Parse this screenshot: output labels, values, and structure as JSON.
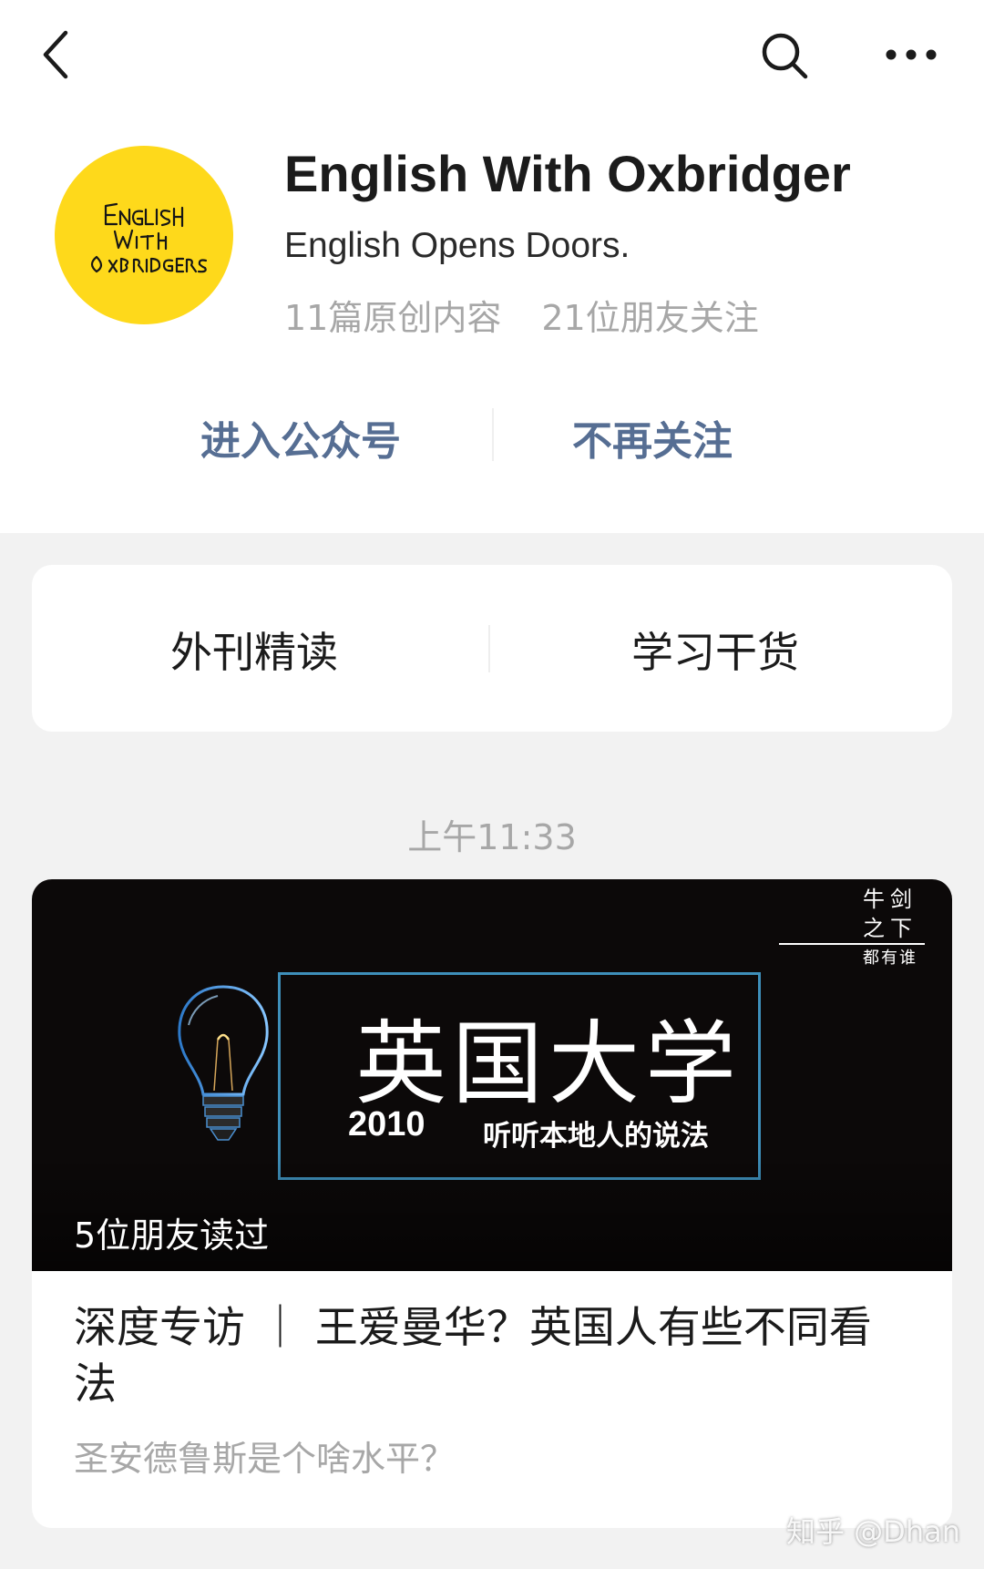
{
  "nav": {
    "back_icon": "chevron-left-icon",
    "search_icon": "search-icon",
    "more_icon": "more-horizontal-icon"
  },
  "account": {
    "avatar_text": "ENGLISH WITH OXBRIDGERS",
    "avatar_color": "#fed91b",
    "name": "English With Oxbridger",
    "slogan": "English Opens Doors.",
    "original_count": "11篇原创内容",
    "friends_following": "21位朋友关注"
  },
  "actions": {
    "enter_label": "进入公众号",
    "unfollow_label": "不再关注",
    "color": "#566e93"
  },
  "menu": {
    "items": [
      {
        "label": "外刊精读"
      },
      {
        "label": "学习干货"
      }
    ]
  },
  "feed": {
    "timestamp": "上午11:33",
    "article": {
      "cover": {
        "badge_line1": "牛剑",
        "badge_line2": "之下",
        "badge_line3": "都有谁",
        "title": "英国大学",
        "year": "2010",
        "subtitle": "听听本地人的说法",
        "frame_color": "#3e8fba",
        "bulb_icon": "lightbulb-icon"
      },
      "read_by": "5位朋友读过",
      "title": "深度专访 ｜ 王爱曼华？英国人有些不同看法",
      "digest": "圣安德鲁斯是个啥水平？"
    }
  },
  "watermark": "知乎 @Dhan"
}
